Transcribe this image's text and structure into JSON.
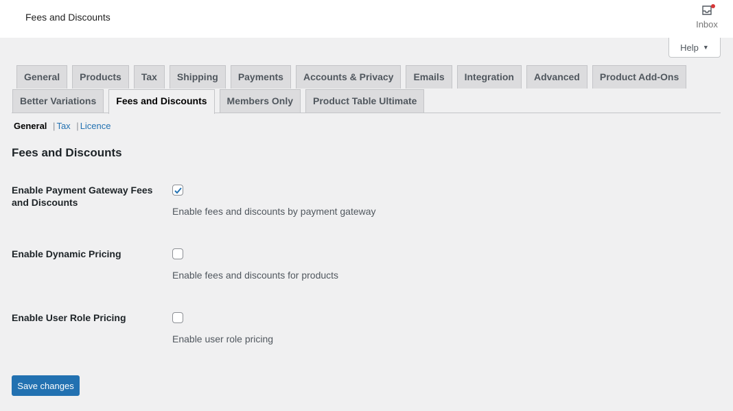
{
  "header": {
    "title": "Fees and Discounts",
    "inbox_label": "Inbox",
    "inbox_icon": "inbox-icon",
    "has_notification": true
  },
  "help": {
    "label": "Help",
    "icon": "triangle-down"
  },
  "tabs": {
    "row1": [
      {
        "label": "General"
      },
      {
        "label": "Products"
      },
      {
        "label": "Tax"
      },
      {
        "label": "Shipping"
      },
      {
        "label": "Payments"
      },
      {
        "label": "Accounts & Privacy"
      },
      {
        "label": "Emails"
      },
      {
        "label": "Integration"
      },
      {
        "label": "Advanced"
      },
      {
        "label": "Product Add-Ons"
      }
    ],
    "row2": [
      {
        "label": "Better Variations"
      },
      {
        "label": "Fees and Discounts",
        "active": true
      },
      {
        "label": "Members Only"
      },
      {
        "label": "Product Table Ultimate"
      }
    ]
  },
  "subnav": {
    "current": "General",
    "links": [
      "Tax",
      "Licence"
    ],
    "separator": "|"
  },
  "section": {
    "title": "Fees and Discounts",
    "fields": [
      {
        "label": "Enable Payment Gateway Fees and Discounts",
        "checked": true,
        "description": "Enable fees and discounts by payment gateway"
      },
      {
        "label": "Enable Dynamic Pricing",
        "checked": false,
        "description": "Enable fees and discounts for products"
      },
      {
        "label": "Enable User Role Pricing",
        "checked": false,
        "description": "Enable user role pricing"
      }
    ]
  },
  "save_label": "Save changes",
  "colors": {
    "accent": "#2271b1",
    "notification": "#d63638",
    "background": "#f0f0f1"
  }
}
